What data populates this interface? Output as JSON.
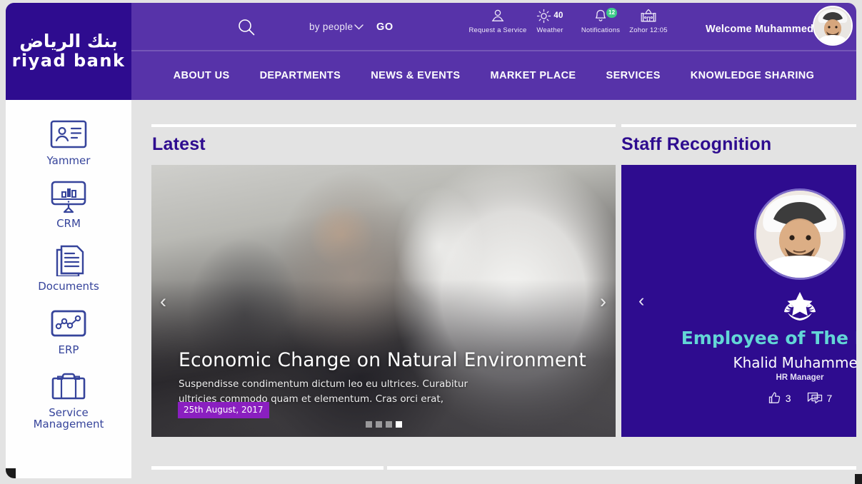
{
  "brand": {
    "logo_arabic": "بنك الرياض",
    "logo_english": "riyad bank",
    "primary_color": "#2e0c8f",
    "header_color": "#5733a9",
    "accent_color": "#8a1fc0",
    "teal_color": "#63d6d6",
    "sidebar_label_color": "#36449b"
  },
  "topbar": {
    "search_icon": "search-icon",
    "search_scope": "by people",
    "scope_chevron": "chevron-down-icon",
    "go_label": "GO",
    "quick_links": [
      {
        "icon": "person-service-icon",
        "label": "Request a Service"
      },
      {
        "icon": "sun-icon",
        "label": "Weather",
        "value": "40"
      },
      {
        "icon": "bell-icon",
        "label": "Notifications",
        "badge": "12"
      },
      {
        "icon": "mosque-icon",
        "label": "Zohor  12:05"
      }
    ],
    "welcome": "Welcome Muhammed",
    "avatar": "user-avatar"
  },
  "mainnav": {
    "items": [
      {
        "label": "ABOUT US"
      },
      {
        "label": "DEPARTMENTS"
      },
      {
        "label": "NEWS & EVENTS"
      },
      {
        "label": "MARKET PLACE"
      },
      {
        "label": "SERVICES"
      },
      {
        "label": "KNOWLEDGE SHARING"
      }
    ]
  },
  "sidebar": {
    "items": [
      {
        "icon": "id-card-icon",
        "label": "Yammer"
      },
      {
        "icon": "monitor-chart-icon",
        "label": "CRM"
      },
      {
        "icon": "documents-icon",
        "label": "Documents"
      },
      {
        "icon": "line-graph-icon",
        "label": "ERP"
      },
      {
        "icon": "briefcase-icon",
        "label": "Service\nManagement"
      }
    ]
  },
  "main": {
    "latest": {
      "title": "Latest",
      "hero": {
        "title": "Economic Change on Natural Environment",
        "description": "Suspendisse condimentum dictum leo eu ultrices. Curabitur ultricies commodo quam et elementum. Cras orci erat,",
        "date": "25th August, 2017",
        "prev_icon": "chevron-left-icon",
        "next_icon": "chevron-right-icon",
        "slide_count": 4,
        "active_slide": 4
      }
    },
    "staff_recognition": {
      "title": "Staff Recognition",
      "award_icon": "star-wreath-icon",
      "award_title": "Employee of The Month",
      "employee_name": "Khalid Muhammed",
      "employee_role": "HR Manager",
      "likes_icon": "thumbs-up-icon",
      "likes": "3",
      "comments_icon": "comment-icon",
      "comments": "7",
      "prev_icon": "chevron-left-icon",
      "next_icon": "chevron-right-icon"
    }
  }
}
